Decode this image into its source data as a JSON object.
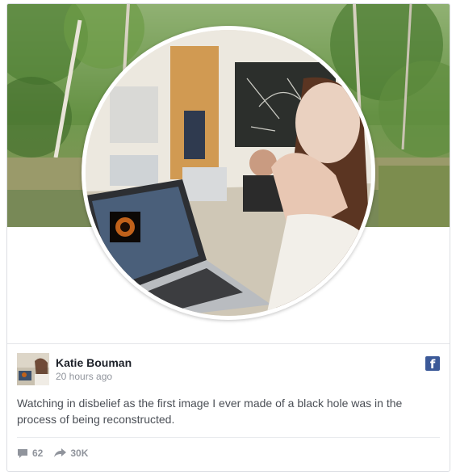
{
  "post": {
    "author": "Katie Bouman",
    "timestamp": "20 hours ago",
    "text": "Watching in disbelief as the first image I ever made of a black hole was in the process of being reconstructed.",
    "platform_icon": "facebook-icon",
    "platform_icon_glyph": "f"
  },
  "stats": {
    "comments_icon": "comment-icon",
    "comments": "62",
    "shares_icon": "share-icon",
    "shares": "30K"
  },
  "colors": {
    "facebook_blue": "#3b5998",
    "author_text": "#1d2129",
    "meta_text": "#90949c",
    "body_text": "#4b4f56"
  }
}
